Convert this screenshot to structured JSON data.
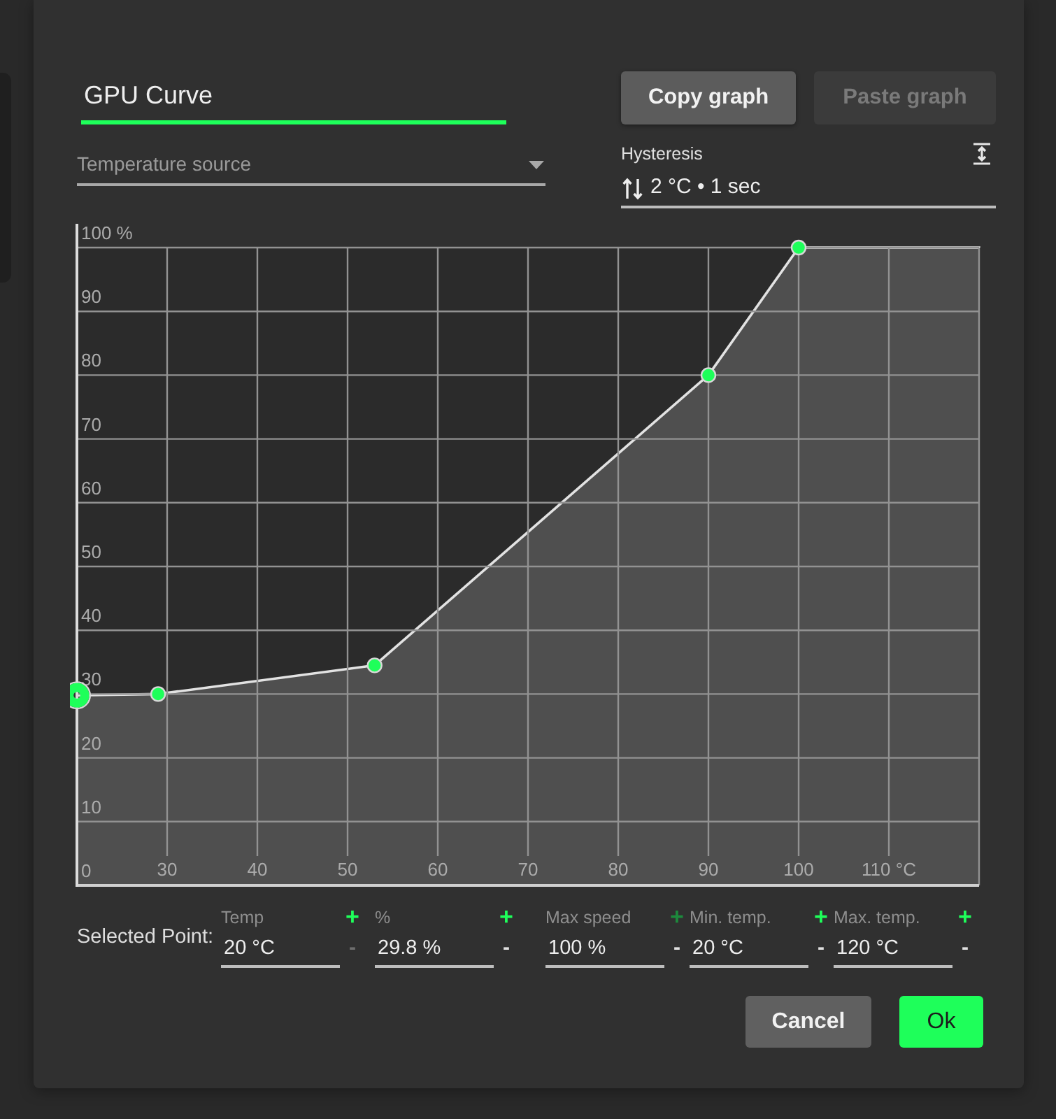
{
  "name_field": {
    "value": "GPU Curve",
    "focused": true
  },
  "graph_buttons": [
    {
      "label": "Copy graph",
      "disabled": false
    },
    {
      "label": "Paste graph",
      "disabled": true
    }
  ],
  "temperature_source": {
    "placeholder": "Temperature source"
  },
  "hysteresis": {
    "label": "Hysteresis",
    "value": "2 °C • 1 sec"
  },
  "chart": {
    "chart_data": {
      "type": "area",
      "x": [
        20,
        29,
        53,
        90,
        100,
        120
      ],
      "values": [
        29.8,
        30,
        34.5,
        80,
        100,
        100
      ],
      "xlim": [
        20,
        120
      ],
      "ylim": [
        0,
        100
      ],
      "grid": true,
      "xticks": [
        30,
        40,
        50,
        60,
        70,
        80,
        90,
        100,
        {
          "value": 110,
          "label": "110 °C"
        }
      ],
      "yticks": [
        {
          "value": 0,
          "label": "0"
        },
        10,
        20,
        30,
        40,
        50,
        60,
        70,
        80,
        90,
        {
          "value": 100,
          "label": "100 %"
        }
      ]
    },
    "handles": [
      {
        "selected": true
      },
      {
        "selected": false
      },
      {
        "selected": false
      },
      {
        "selected": false
      },
      {
        "selected": false
      }
    ]
  },
  "selected_point": {
    "label": "Selected Point:",
    "fields": [
      {
        "label": "Temp",
        "value": "20 °C",
        "plus": "+",
        "minus": "-",
        "plus_disabled": false,
        "minus_disabled": true
      },
      {
        "label": "%",
        "value": "29.8 %",
        "plus": "+",
        "minus": "-",
        "plus_disabled": false,
        "minus_disabled": false
      }
    ]
  },
  "limits": {
    "fields": [
      {
        "label": "Max speed",
        "value": "100 %",
        "plus": "+",
        "minus": "-",
        "plus_disabled": true,
        "minus_disabled": false
      },
      {
        "label": "Min. temp.",
        "value": "20 °C",
        "plus": "+",
        "minus": "-",
        "plus_disabled": false,
        "minus_disabled": false
      },
      {
        "label": "Max. temp.",
        "value": "120 °C",
        "plus": "+",
        "minus": "-",
        "plus_disabled": false,
        "minus_disabled": false
      }
    ]
  },
  "buttons": [
    {
      "label": "Cancel",
      "kind": "secondary"
    },
    {
      "label": "Ok",
      "kind": "primary"
    }
  ]
}
